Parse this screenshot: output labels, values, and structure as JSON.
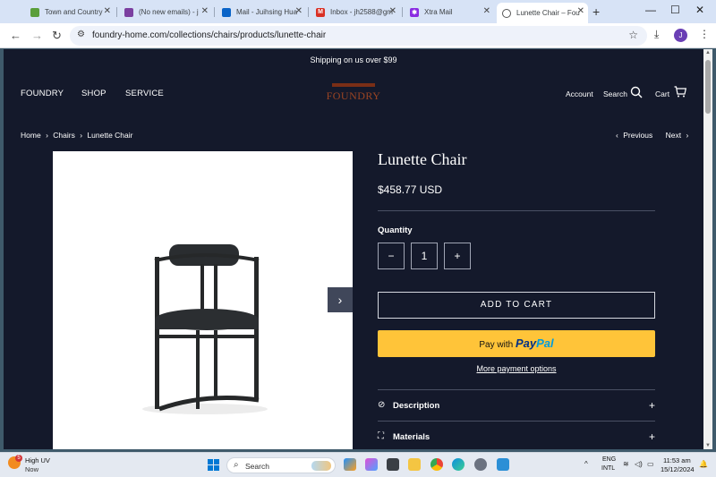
{
  "browser": {
    "tabs": [
      {
        "title": "Town and Country",
        "favicon_color": "#5a9e3a"
      },
      {
        "title": "(No new emails) - j",
        "favicon_color": "#7b3fa0"
      },
      {
        "title": "Mail - Juihsing Hua",
        "favicon_color": "#0a64c8"
      },
      {
        "title": "Inbox - jh2588@gm",
        "favicon_color": "#d93025"
      },
      {
        "title": "Xtra Mail",
        "favicon_color": "#8a2be2"
      },
      {
        "title": "Lunette Chair – Fou",
        "favicon_color": "#555555"
      }
    ],
    "url": "foundry-home.com/collections/chairs/products/lunette-chair",
    "profile_initial": "J"
  },
  "store": {
    "announcement": "Shipping on us over $99",
    "nav_left": [
      "FOUNDRY",
      "SHOP",
      "SERVICE"
    ],
    "logo_text": "FOUNDRY",
    "nav_right": {
      "account": "Account",
      "search": "Search",
      "cart": "Cart"
    },
    "breadcrumb": [
      "Home",
      "Chairs",
      "Lunette Chair"
    ],
    "pager": {
      "previous": "Previous",
      "next": "Next"
    }
  },
  "product": {
    "title": "Lunette Chair",
    "price": "$458.77 USD",
    "quantity_label": "Quantity",
    "quantity": "1",
    "add_to_cart": "ADD TO CART",
    "paypal_prefix": "Pay with",
    "paypal_brand_1": "Pay",
    "paypal_brand_2": "Pal",
    "more_payment": "More payment options",
    "accordions": [
      {
        "label": "Description",
        "icon": "check-circle-icon"
      },
      {
        "label": "Materials",
        "icon": "ruler-icon"
      }
    ]
  },
  "taskbar": {
    "weather_title": "High UV",
    "weather_sub": "Now",
    "weather_badge": "5",
    "search_placeholder": "Search",
    "lang1": "ENG",
    "lang2": "INTL",
    "time": "11:53 am",
    "date": "15/12/2024"
  }
}
